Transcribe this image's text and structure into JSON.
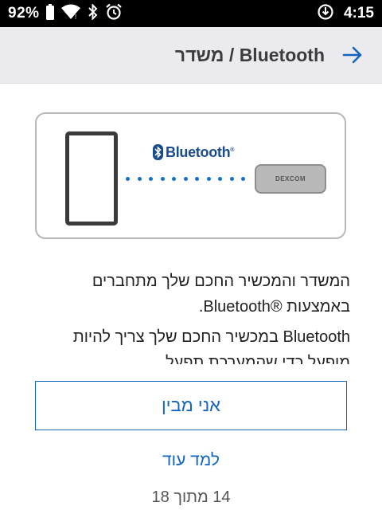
{
  "status_bar": {
    "battery": "92%",
    "time": "4:15",
    "icons": [
      "battery-icon",
      "wifi-icon",
      "bluetooth-icon",
      "alarm-icon",
      "data-saver-icon"
    ]
  },
  "header": {
    "title": "Bluetooth / משדר",
    "back_icon": "arrow-right-icon",
    "accent_color": "#1565c0"
  },
  "illustration": {
    "bluetooth_label": "Bluetooth",
    "registered_mark": "®",
    "transmitter_label": "DEXCOM"
  },
  "body": {
    "paragraph1": "המשדר והמכשיר החכם שלך מתחברים באמצעות ®Bluetooth.",
    "paragraph2": "Bluetooth במכשיר החכם שלך צריך להיות מופעל כדי שהמערכת תפעל."
  },
  "buttons": {
    "understand": "אני מבין",
    "learn_more": "למד עוד"
  },
  "pagination": {
    "text": "14 מתוך 18"
  }
}
